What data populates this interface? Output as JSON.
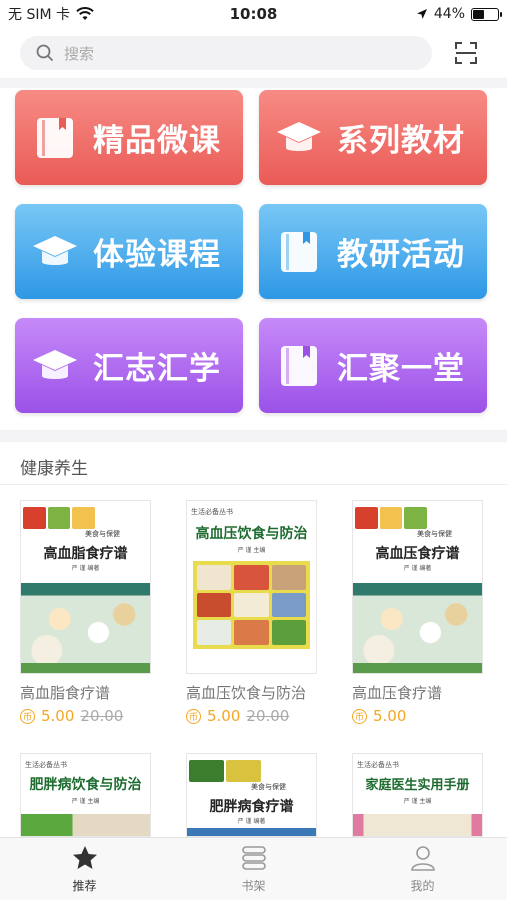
{
  "status_bar": {
    "carrier": "无 SIM 卡",
    "time": "10:08",
    "battery_percent": "44%",
    "battery_level": 0.44
  },
  "search": {
    "placeholder": "搜索"
  },
  "tiles": [
    {
      "label": "精品微课",
      "icon": "book-icon",
      "color": "#ea5b57"
    },
    {
      "label": "系列教材",
      "icon": "graduation-cap-icon",
      "color": "#ea5b57"
    },
    {
      "label": "体验课程",
      "icon": "graduation-cap-icon",
      "color": "#2e98e6"
    },
    {
      "label": "教研活动",
      "icon": "book-icon",
      "color": "#2e98e6"
    },
    {
      "label": "汇志汇学",
      "icon": "graduation-cap-icon",
      "color": "#9b51e8"
    },
    {
      "label": "汇聚一堂",
      "icon": "book-icon",
      "color": "#9b51e8"
    }
  ],
  "section": {
    "title": "健康养生"
  },
  "books": [
    {
      "name": "高血脂食疗谱",
      "price": "5.00",
      "original_price": "20.00",
      "cover_title": "高血脂食疗谱",
      "cover_series": "",
      "cover_subtitle": "美食与保健",
      "cover_author": "严 谨 编著"
    },
    {
      "name": "高血压饮食与防治",
      "price": "5.00",
      "original_price": "20.00",
      "cover_title": "高血压饮食与防治",
      "cover_series": "生活必备丛书",
      "cover_subtitle": "",
      "cover_author": "严 谨 主编"
    },
    {
      "name": "高血压食疗谱",
      "price": "5.00",
      "original_price": "",
      "cover_title": "高血压食疗谱",
      "cover_series": "",
      "cover_subtitle": "美食与保健",
      "cover_author": "严 谨 编著"
    },
    {
      "name": "",
      "price": "",
      "original_price": "",
      "cover_title": "肥胖病饮食与防治",
      "cover_series": "生活必备丛书",
      "cover_subtitle": "",
      "cover_author": "严 谨 主编"
    },
    {
      "name": "",
      "price": "",
      "original_price": "",
      "cover_title": "肥胖病食疗谱",
      "cover_series": "",
      "cover_subtitle": "美食与保健",
      "cover_author": "严 谨 编著"
    },
    {
      "name": "",
      "price": "",
      "original_price": "",
      "cover_title": "家庭医生实用手册",
      "cover_series": "生活必备丛书",
      "cover_subtitle": "",
      "cover_author": "严 谨 主编"
    }
  ],
  "tabbar": {
    "items": [
      {
        "label": "推荐",
        "icon": "star-icon",
        "active": true
      },
      {
        "label": "书架",
        "icon": "bookshelf-icon",
        "active": false
      },
      {
        "label": "我的",
        "icon": "profile-icon",
        "active": false
      }
    ]
  },
  "colors": {
    "accent_price": "#f5a623",
    "tile_red": "#ea5b57",
    "tile_blue": "#2e98e6",
    "tile_purple": "#9b51e8"
  }
}
